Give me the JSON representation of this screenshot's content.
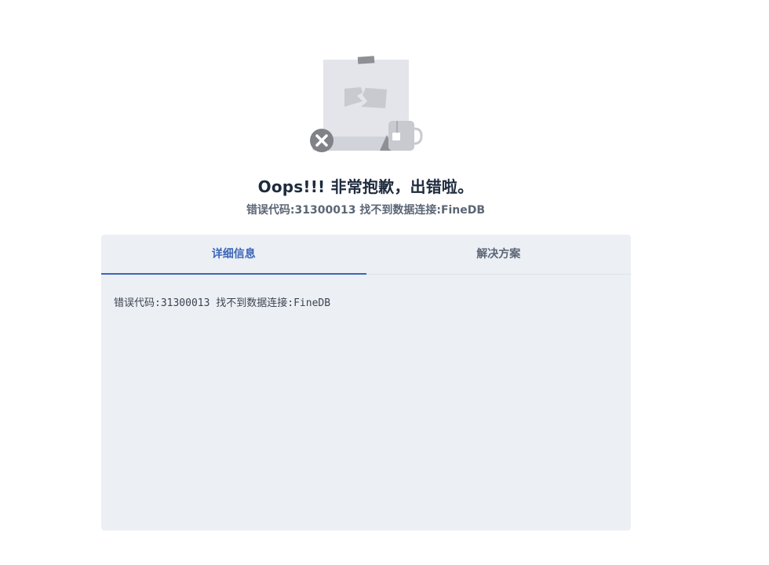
{
  "error": {
    "title": "Oops!!! 非常抱歉，出错啦。",
    "summary": "错误代码:31300013 找不到数据连接:FineDB"
  },
  "tabs": [
    {
      "label": "详细信息",
      "active": true
    },
    {
      "label": "解决方案",
      "active": false
    }
  ],
  "detail": {
    "text": "错误代码:31300013 找不到数据连接:FineDB"
  },
  "colors": {
    "accent": "#3b66b8",
    "panel_bg": "#eceff4",
    "title": "#1e2b3e",
    "muted": "#5b6675"
  },
  "icons": {
    "illustration": "broken-document-with-mug-illustration",
    "error_badge": "close-icon"
  }
}
